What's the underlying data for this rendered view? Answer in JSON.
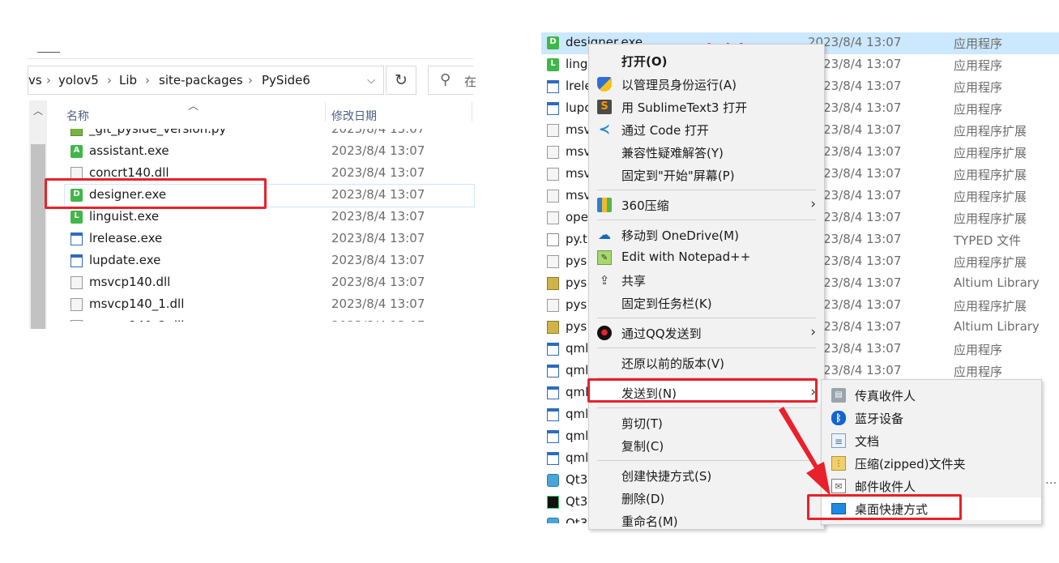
{
  "left_explorer": {
    "breadcrumb": [
      "vs",
      "yolov5",
      "Lib",
      "site-packages",
      "PySide6"
    ],
    "search_placeholder": "在",
    "columns": {
      "name": "名称",
      "date": "修改日期"
    },
    "files": [
      {
        "name": "_git_pyside_version.py",
        "date": "2023/8/4 13:07",
        "icon": "python-file-icon"
      },
      {
        "name": "assistant.exe",
        "date": "2023/8/4 13:07",
        "icon": "qt-assistant-icon"
      },
      {
        "name": "concrt140.dll",
        "date": "2023/8/4 13:07",
        "icon": "dll-file-icon"
      },
      {
        "name": "designer.exe",
        "date": "2023/8/4 13:07",
        "icon": "qt-designer-icon"
      },
      {
        "name": "linguist.exe",
        "date": "2023/8/4 13:07",
        "icon": "qt-linguist-icon"
      },
      {
        "name": "lrelease.exe",
        "date": "2023/8/4 13:07",
        "icon": "window-app-icon"
      },
      {
        "name": "lupdate.exe",
        "date": "2023/8/4 13:07",
        "icon": "window-app-icon"
      },
      {
        "name": "msvcp140.dll",
        "date": "2023/8/4 13:07",
        "icon": "dll-file-icon"
      },
      {
        "name": "msvcp140_1.dll",
        "date": "2023/8/4 13:07",
        "icon": "dll-file-icon"
      },
      {
        "name": "msvcp140_2.dll",
        "date": "2023/8/4 13:07",
        "icon": "dll-file-icon"
      }
    ]
  },
  "right_explorer": {
    "files": [
      {
        "name": "designer.exe",
        "date": "2023/8/4 13:07",
        "type": "应用程序"
      },
      {
        "name": "ling",
        "date": "2023/8/4 13:07",
        "type": "应用程序"
      },
      {
        "name": "lrele",
        "date": "2023/8/4 13:07",
        "type": "应用程序"
      },
      {
        "name": "lupc",
        "date": "2023/8/4 13:07",
        "type": "应用程序"
      },
      {
        "name": "msv",
        "date": "2023/8/4 13:07",
        "type": "应用程序扩展"
      },
      {
        "name": "msv",
        "date": "2023/8/4 13:07",
        "type": "应用程序扩展"
      },
      {
        "name": "msv",
        "date": "2023/8/4 13:07",
        "type": "应用程序扩展"
      },
      {
        "name": "msv",
        "date": "2023/8/4 13:07",
        "type": "应用程序扩展"
      },
      {
        "name": "ope",
        "date": "2023/8/4 13:07",
        "type": "应用程序扩展"
      },
      {
        "name": "py.t",
        "date": "2023/8/4 13:07",
        "type": "TYPED 文件"
      },
      {
        "name": "pys",
        "date": "2023/8/4 13:07",
        "type": "应用程序扩展"
      },
      {
        "name": "pys",
        "date": "2023/8/4 13:07",
        "type": "Altium Library"
      },
      {
        "name": "pys",
        "date": "2023/8/4 13:07",
        "type": "应用程序扩展"
      },
      {
        "name": "pys",
        "date": "2023/8/4 13:07",
        "type": "Altium Library"
      },
      {
        "name": "qml",
        "date": "2023/8/4 13:07",
        "type": "应用程序"
      },
      {
        "name": "qml",
        "date": "2023/8/4 13:07",
        "type": "应用程序"
      },
      {
        "name": "qml",
        "date": "",
        "type": ""
      },
      {
        "name": "qml",
        "date": "",
        "type": ""
      },
      {
        "name": "qml",
        "date": "",
        "type": ""
      },
      {
        "name": "qml",
        "date": "",
        "type": ""
      },
      {
        "name": "Qt3",
        "date": "",
        "type": ""
      },
      {
        "name": "Qt3",
        "date": "",
        "type": ""
      },
      {
        "name": "Qt3",
        "date": "",
        "type": ""
      }
    ],
    "truncated_type": "..."
  },
  "annotation": "右键",
  "context_menu": {
    "items": [
      {
        "label": "打开(O)",
        "bold": true
      },
      {
        "label": "以管理员身份运行(A)"
      },
      {
        "label": "用 SublimeText3 打开"
      },
      {
        "label": "通过 Code 打开"
      },
      {
        "label": "兼容性疑难解答(Y)"
      },
      {
        "label": "固定到\"开始\"屏幕(P)"
      },
      {
        "label": "360压缩"
      },
      {
        "label": "移动到 OneDrive(M)"
      },
      {
        "label": "Edit with Notepad++"
      },
      {
        "label": "共享"
      },
      {
        "label": "固定到任务栏(K)"
      },
      {
        "label": "通过QQ发送到"
      },
      {
        "label": "还原以前的版本(V)"
      },
      {
        "label": "发送到(N)"
      },
      {
        "label": "剪切(T)"
      },
      {
        "label": "复制(C)"
      },
      {
        "label": "创建快捷方式(S)"
      },
      {
        "label": "删除(D)"
      },
      {
        "label": "重命名(M)"
      }
    ]
  },
  "send_to_menu": {
    "items": [
      {
        "label": "传真收件人"
      },
      {
        "label": "蓝牙设备"
      },
      {
        "label": "文档"
      },
      {
        "label": "压缩(zipped)文件夹"
      },
      {
        "label": "邮件收件人"
      },
      {
        "label": "桌面快捷方式"
      }
    ]
  },
  "colors": {
    "highlight_red": "#e8212b",
    "selection_blue": "#cce8ff"
  }
}
